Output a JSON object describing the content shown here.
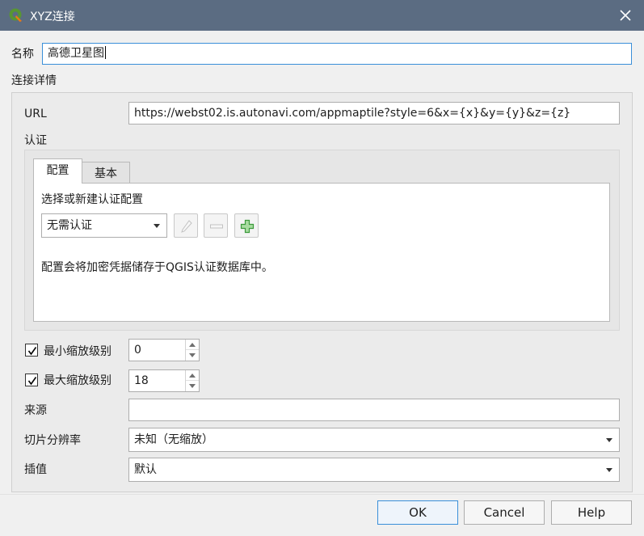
{
  "window": {
    "title": "XYZ连接",
    "icon": "qgis-logo-icon",
    "close_icon": "close-icon"
  },
  "name": {
    "label": "名称",
    "value": "高德卫星图"
  },
  "connection_details": {
    "label": "连接详情",
    "url_label": "URL",
    "url_value": "https://webst02.is.autonavi.com/appmaptile?style=6&x={x}&y={y}&z={z}",
    "auth_label": "认证",
    "tabs": [
      {
        "label": "配置",
        "active": true
      },
      {
        "label": "基本",
        "active": false
      }
    ],
    "config_prompt": "选择或新建认证配置",
    "auth_select_value": "无需认证",
    "config_note": "配置会将加密凭据储存于QGIS认证数据库中。"
  },
  "zoom": {
    "min_label": "最小缩放级别",
    "min_checked": true,
    "min_value": "0",
    "max_label": "最大缩放级别",
    "max_checked": true,
    "max_value": "18"
  },
  "source": {
    "label": "来源",
    "value": ""
  },
  "tile_resolution": {
    "label": "切片分辨率",
    "value": "未知（无缩放）"
  },
  "interpolation": {
    "label": "插值",
    "value": "默认"
  },
  "buttons": {
    "ok": "OK",
    "cancel": "Cancel",
    "help": "Help"
  },
  "colors": {
    "titlebar": "#5b6c82",
    "focus_border": "#3a8fd9",
    "add_icon": "#3c9a3c"
  }
}
